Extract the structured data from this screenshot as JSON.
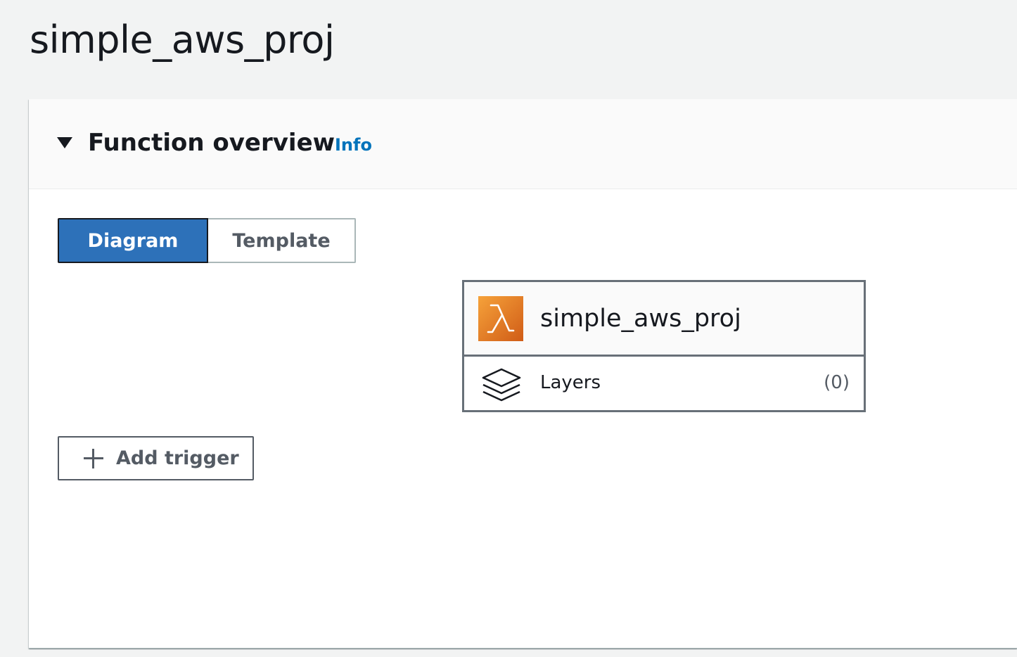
{
  "page": {
    "title": "simple_aws_proj"
  },
  "overview": {
    "title": "Function overview",
    "info_label": "Info",
    "tabs": [
      {
        "label": "Diagram",
        "active": true
      },
      {
        "label": "Template",
        "active": false
      }
    ]
  },
  "function_card": {
    "name": "simple_aws_proj",
    "icon": "lambda-icon",
    "layers_label": "Layers",
    "layers_count": "(0)"
  },
  "actions": {
    "add_trigger_label": "Add trigger"
  },
  "colors": {
    "accent": "#0073bb",
    "active_tab": "#2d71b9",
    "lambda_orange": "#e0741f"
  }
}
